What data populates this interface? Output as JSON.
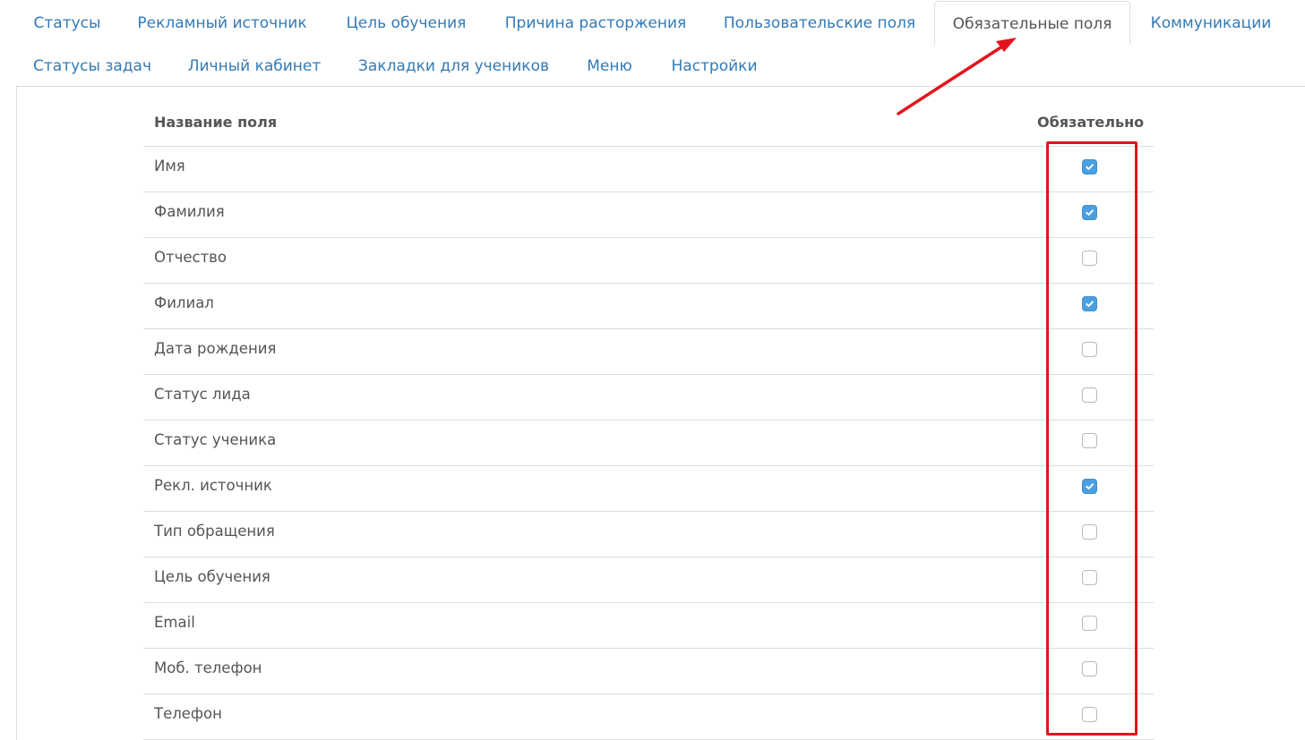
{
  "tabs_row1": [
    {
      "label": "Статусы",
      "active": false
    },
    {
      "label": "Рекламный источник",
      "active": false
    },
    {
      "label": "Цель обучения",
      "active": false
    },
    {
      "label": "Причина расторжения",
      "active": false
    },
    {
      "label": "Пользовательские поля",
      "active": false
    },
    {
      "label": "Обязательные поля",
      "active": true
    },
    {
      "label": "Коммуникации",
      "active": false
    }
  ],
  "tabs_row2": [
    {
      "label": "Статусы задач",
      "active": false
    },
    {
      "label": "Личный кабинет",
      "active": false
    },
    {
      "label": "Закладки для учеников",
      "active": false
    },
    {
      "label": "Меню",
      "active": false
    },
    {
      "label": "Настройки",
      "active": false
    }
  ],
  "table": {
    "header_name": "Название поля",
    "header_required": "Обязательно",
    "rows": [
      {
        "label": "Имя",
        "required": true
      },
      {
        "label": "Фамилия",
        "required": true
      },
      {
        "label": "Отчество",
        "required": false
      },
      {
        "label": "Филиал",
        "required": true
      },
      {
        "label": "Дата рождения",
        "required": false
      },
      {
        "label": "Статус лида",
        "required": false
      },
      {
        "label": "Статус ученика",
        "required": false
      },
      {
        "label": "Рекл. источник",
        "required": true
      },
      {
        "label": "Тип обращения",
        "required": false
      },
      {
        "label": "Цель обучения",
        "required": false
      },
      {
        "label": "Email",
        "required": false
      },
      {
        "label": "Моб. телефон",
        "required": false
      },
      {
        "label": "Телефон",
        "required": false
      }
    ]
  },
  "colors": {
    "link": "#337ab7",
    "checkbox_checked": "#4a9fe0",
    "annotation": "#e3141c"
  }
}
